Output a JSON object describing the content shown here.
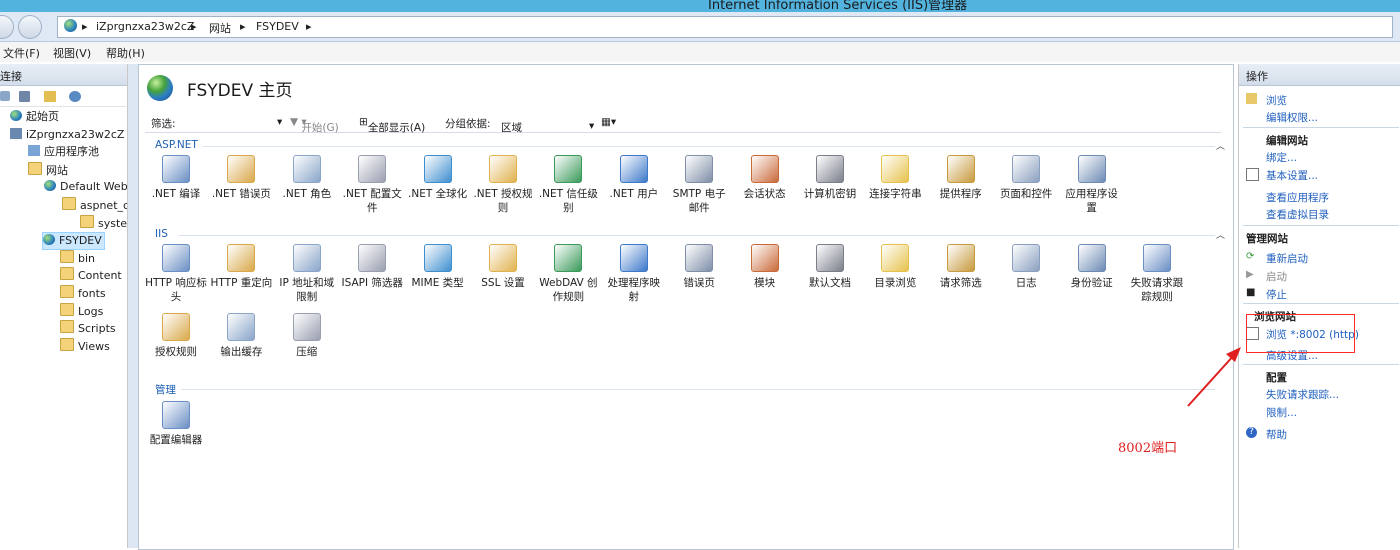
{
  "window": {
    "title": "Internet Information Services (IIS)管理器"
  },
  "address": {
    "segments": [
      "iZprgnzxa23w2cZ",
      "网站",
      "FSYDEV"
    ],
    "separator": "▸"
  },
  "menu": [
    "文件(F)",
    "视图(V)",
    "帮助(H)"
  ],
  "connections": {
    "title": "连接",
    "tree": [
      {
        "label": "起始页"
      },
      {
        "label": "iZprgnzxa23w2cZ ("
      },
      {
        "label": "应用程序池"
      },
      {
        "label": "网站"
      },
      {
        "label": "Default Web"
      },
      {
        "label": "aspnet_cl"
      },
      {
        "label": "syster"
      },
      {
        "label": "FSYDEV"
      },
      {
        "label": "bin"
      },
      {
        "label": "Content"
      },
      {
        "label": "fonts"
      },
      {
        "label": "Logs"
      },
      {
        "label": "Scripts"
      },
      {
        "label": "Views"
      }
    ]
  },
  "main": {
    "title": "FSYDEV 主页",
    "filter": {
      "label": "筛选:",
      "start": "开始(G)",
      "show_all": "全部显示(A)",
      "group_by_label": "分组依据:",
      "group_by_value": "区域"
    },
    "groups": [
      {
        "name": "ASP.NET",
        "items": [
          ".NET 编译",
          ".NET 错误页",
          ".NET 角色",
          ".NET 配置文件",
          ".NET 全球化",
          ".NET 授权规则",
          ".NET 信任级别",
          ".NET 用户",
          "SMTP 电子邮件",
          "会话状态",
          "计算机密钥",
          "连接字符串",
          "提供程序",
          "页面和控件",
          "应用程序设置"
        ]
      },
      {
        "name": "IIS",
        "items": [
          "HTTP 响应标头",
          "HTTP 重定向",
          "IP 地址和域限制",
          "ISAPI 筛选器",
          "MIME 类型",
          "SSL 设置",
          "WebDAV 创作规则",
          "处理程序映射",
          "错误页",
          "模块",
          "默认文档",
          "目录浏览",
          "请求筛选",
          "日志",
          "身份验证",
          "失败请求跟踪规则",
          "授权规则",
          "输出缓存",
          "压缩"
        ]
      },
      {
        "name": "管理",
        "items": [
          "配置编辑器"
        ]
      }
    ]
  },
  "actions": {
    "title": "操作",
    "browse": "浏览",
    "edit_permissions": "编辑权限...",
    "edit_site": "编辑网站",
    "bindings": "绑定...",
    "basic_settings": "基本设置...",
    "view_apps": "查看应用程序",
    "view_vdirs": "查看虚拟目录",
    "manage_site": "管理网站",
    "restart": "重新启动",
    "start": "启动",
    "stop": "停止",
    "browse_site": "浏览网站",
    "browse_port": "浏览 *:8002 (http)",
    "advanced_settings": "高级设置...",
    "config": "配置",
    "failed_tracing": "失败请求跟踪...",
    "limits": "限制...",
    "help": "帮助"
  },
  "annotation": {
    "text": "8002端口",
    "color": "#e02020"
  }
}
